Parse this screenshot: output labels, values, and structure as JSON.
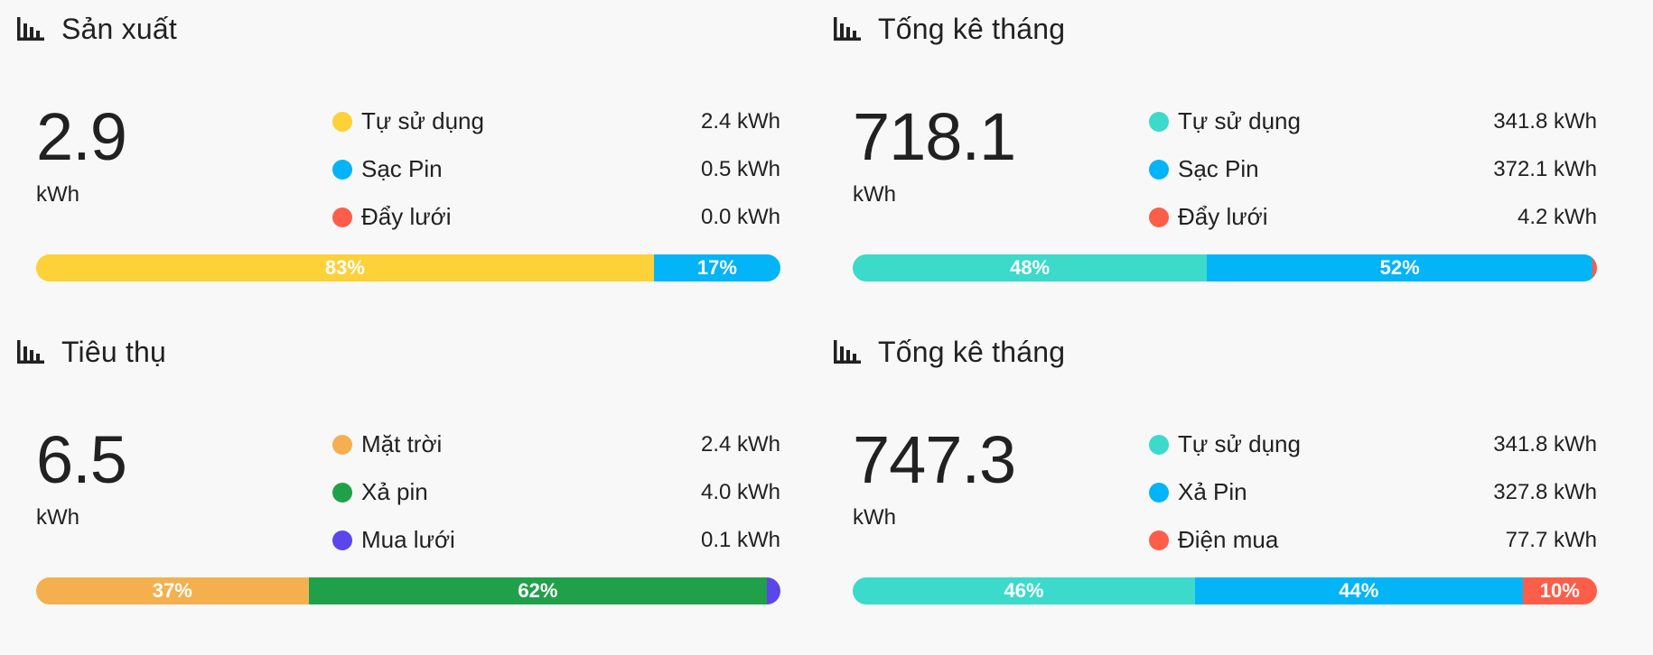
{
  "colors": {
    "yellow": "#fdd138",
    "blue": "#03b4f7",
    "red": "#fc5e4a",
    "teal": "#3cdacb",
    "orange": "#f4b04f",
    "green": "#21a04a",
    "purple": "#5b46ec"
  },
  "icon": "bar-chart-icon",
  "cards": [
    {
      "title": "Sản xuất",
      "total": "2.9",
      "unit": "kWh",
      "legend": [
        {
          "label": "Tự sử dụng",
          "value": "2.4 kWh",
          "color": "#fdd138"
        },
        {
          "label": "Sạc Pin",
          "value": "0.5 kWh",
          "color": "#03b4f7"
        },
        {
          "label": "Đẩy lưới",
          "value": "0.0 kWh",
          "color": "#fc5e4a"
        }
      ],
      "bar": [
        {
          "label": "83%",
          "percent": 83,
          "color": "#fdd138"
        },
        {
          "label": "17%",
          "percent": 17,
          "color": "#03b4f7"
        }
      ]
    },
    {
      "title": "Tống kê tháng",
      "total": "718.1",
      "unit": "kWh",
      "legend": [
        {
          "label": "Tự sử dụng",
          "value": "341.8 kWh",
          "color": "#3cdacb"
        },
        {
          "label": "Sạc Pin",
          "value": "372.1 kWh",
          "color": "#03b4f7"
        },
        {
          "label": "Đẩy lưới",
          "value": "4.2 kWh",
          "color": "#fc5e4a"
        }
      ],
      "bar": [
        {
          "label": "48%",
          "percent": 47.6,
          "color": "#3cdacb"
        },
        {
          "label": "52%",
          "percent": 51.8,
          "color": "#03b4f7"
        },
        {
          "label": "",
          "percent": 0.6,
          "color": "#fc5e4a"
        }
      ]
    },
    {
      "title": "Tiêu thụ",
      "total": "6.5",
      "unit": "kWh",
      "legend": [
        {
          "label": "Mặt trời",
          "value": "2.4 kWh",
          "color": "#f4b04f"
        },
        {
          "label": "Xả pin",
          "value": "4.0 kWh",
          "color": "#21a04a"
        },
        {
          "label": "Mua lưới",
          "value": "0.1 kWh",
          "color": "#5b46ec"
        }
      ],
      "bar": [
        {
          "label": "37%",
          "percent": 36.6,
          "color": "#f4b04f"
        },
        {
          "label": "62%",
          "percent": 61.6,
          "color": "#21a04a"
        },
        {
          "label": "",
          "percent": 1.8,
          "color": "#5b46ec"
        }
      ]
    },
    {
      "title": "Tống kê tháng",
      "total": "747.3",
      "unit": "kWh",
      "legend": [
        {
          "label": "Tự sử dụng",
          "value": "341.8 kWh",
          "color": "#3cdacb"
        },
        {
          "label": "Xả Pin",
          "value": "327.8 kWh",
          "color": "#03b4f7"
        },
        {
          "label": "Điện mua",
          "value": "77.7 kWh",
          "color": "#fc5e4a"
        }
      ],
      "bar": [
        {
          "label": "46%",
          "percent": 46,
          "color": "#3cdacb"
        },
        {
          "label": "44%",
          "percent": 44,
          "color": "#03b4f7"
        },
        {
          "label": "10%",
          "percent": 10,
          "color": "#fc5e4a"
        }
      ]
    }
  ]
}
